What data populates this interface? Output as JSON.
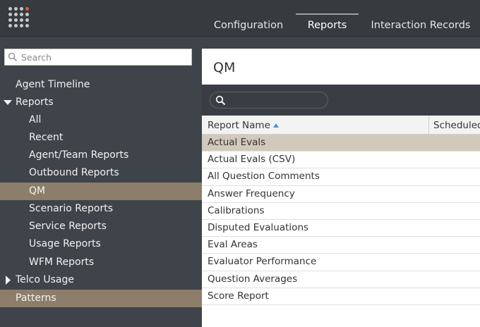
{
  "header": {
    "tabs": [
      {
        "label": "Configuration"
      },
      {
        "label": "Reports"
      },
      {
        "label": "Interaction Records"
      }
    ]
  },
  "sidebar": {
    "search_placeholder": "Search",
    "items": [
      {
        "label": "Agent Timeline"
      },
      {
        "label": "Reports"
      },
      {
        "label": "All"
      },
      {
        "label": "Recent"
      },
      {
        "label": "Agent/Team Reports"
      },
      {
        "label": "Outbound Reports"
      },
      {
        "label": "QM"
      },
      {
        "label": "Scenario Reports"
      },
      {
        "label": "Service Reports"
      },
      {
        "label": "Usage Reports"
      },
      {
        "label": "WFM Reports"
      },
      {
        "label": "Telco Usage"
      },
      {
        "label": "Patterns"
      }
    ]
  },
  "main": {
    "title": "QM",
    "filter_value": "",
    "columns": [
      {
        "label": "Report Name"
      },
      {
        "label": "Scheduled"
      }
    ],
    "rows": [
      {
        "name": "Actual Evals"
      },
      {
        "name": "Actual Evals (CSV)"
      },
      {
        "name": "All Question Comments"
      },
      {
        "name": "Answer Frequency"
      },
      {
        "name": "Calibrations"
      },
      {
        "name": "Disputed Evaluations"
      },
      {
        "name": "Eval Areas"
      },
      {
        "name": "Evaluator Performance"
      },
      {
        "name": "Question Averages"
      },
      {
        "name": "Score Report"
      }
    ]
  },
  "colors": {
    "topbar": "#373a3f",
    "sidebar": "#3f434a",
    "selected_sidebar": "#8c7e6a",
    "selected_row": "#d2c9bb",
    "sort_accent": "#4a90d9"
  }
}
